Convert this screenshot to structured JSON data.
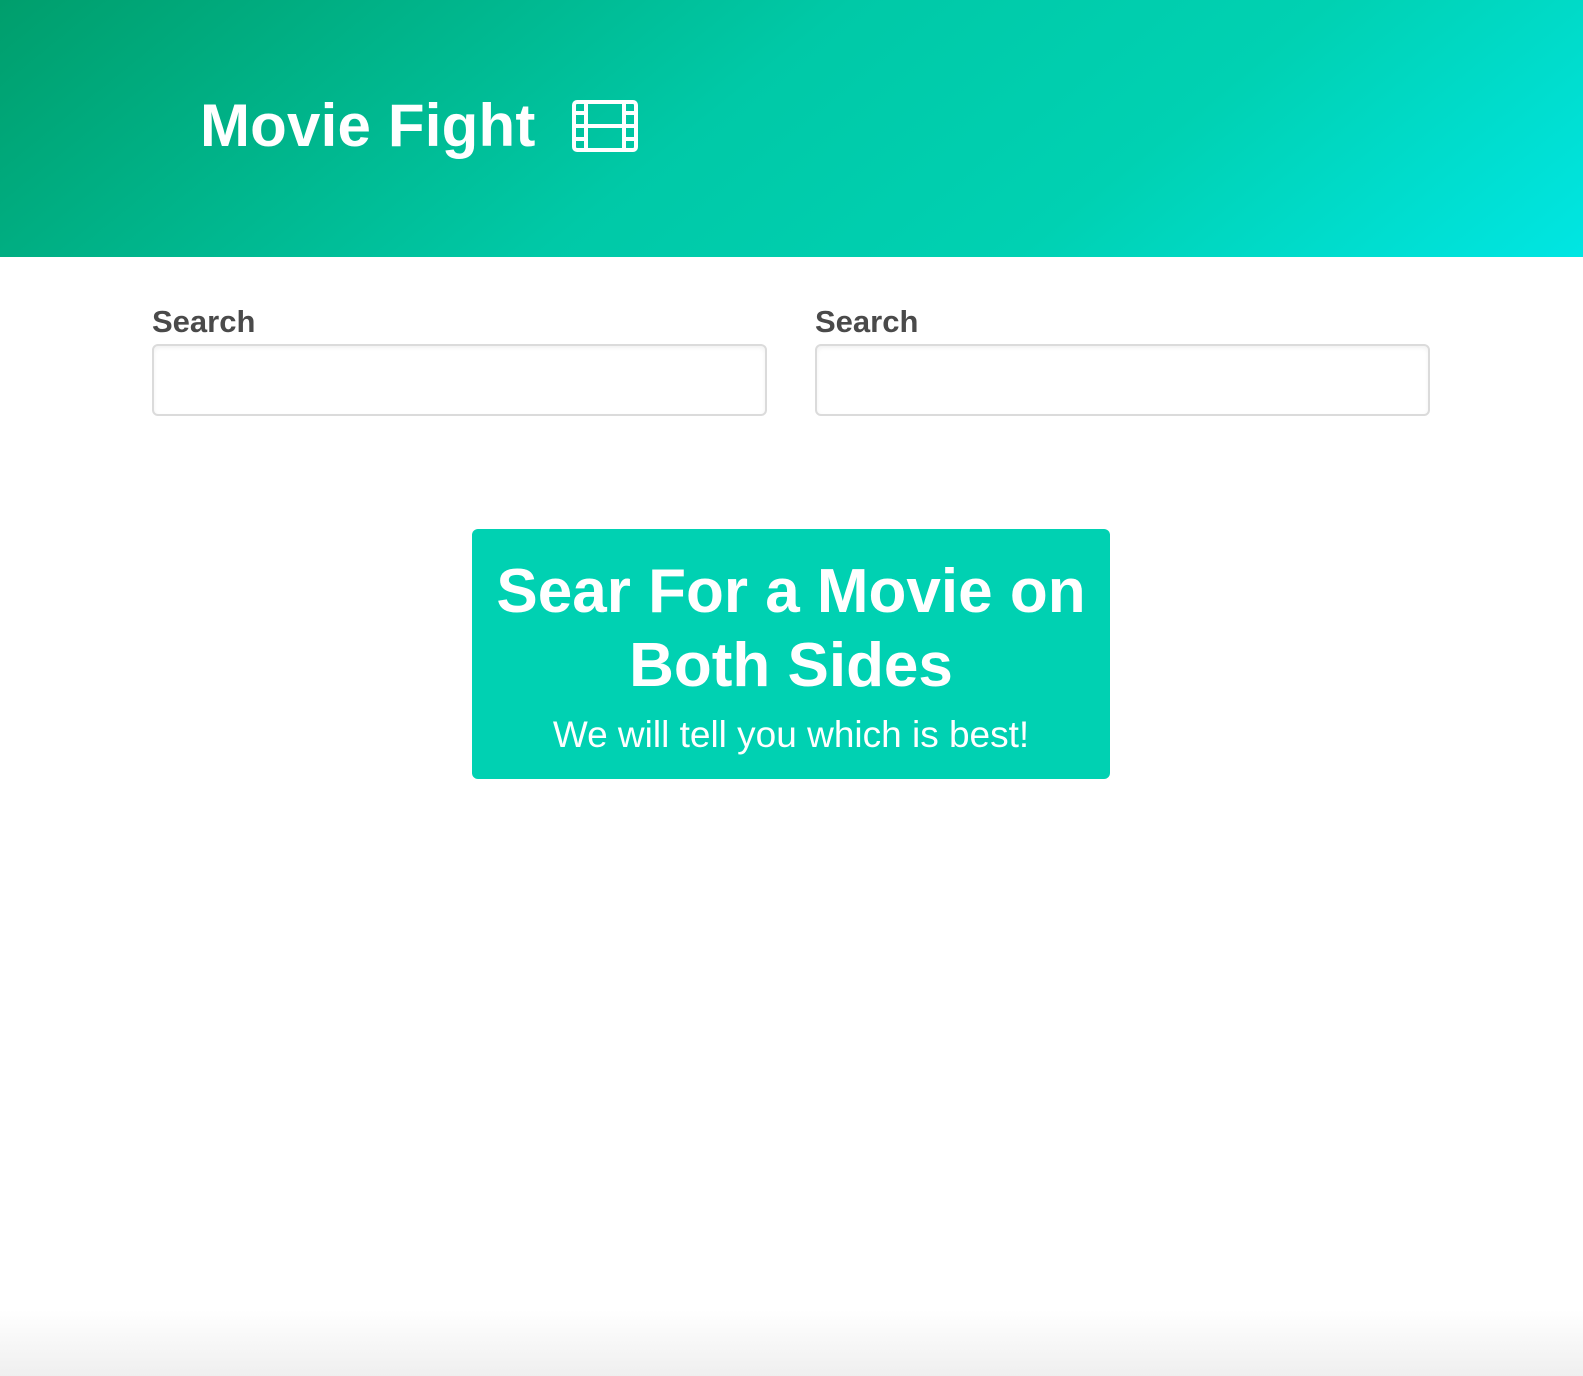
{
  "hero": {
    "title": "Movie Fight",
    "icon": "film-icon"
  },
  "search_left": {
    "label": "Search",
    "value": "",
    "placeholder": ""
  },
  "search_right": {
    "label": "Search",
    "value": "",
    "placeholder": ""
  },
  "tutorial": {
    "heading": "Sear For a Movie on Both Sides",
    "subtitle": "We will tell you which is best!"
  },
  "colors": {
    "primary": "#00d1b2",
    "gradient_start": "#009e6c",
    "gradient_end": "#00e6e3",
    "label_text": "#4a4a4a"
  }
}
